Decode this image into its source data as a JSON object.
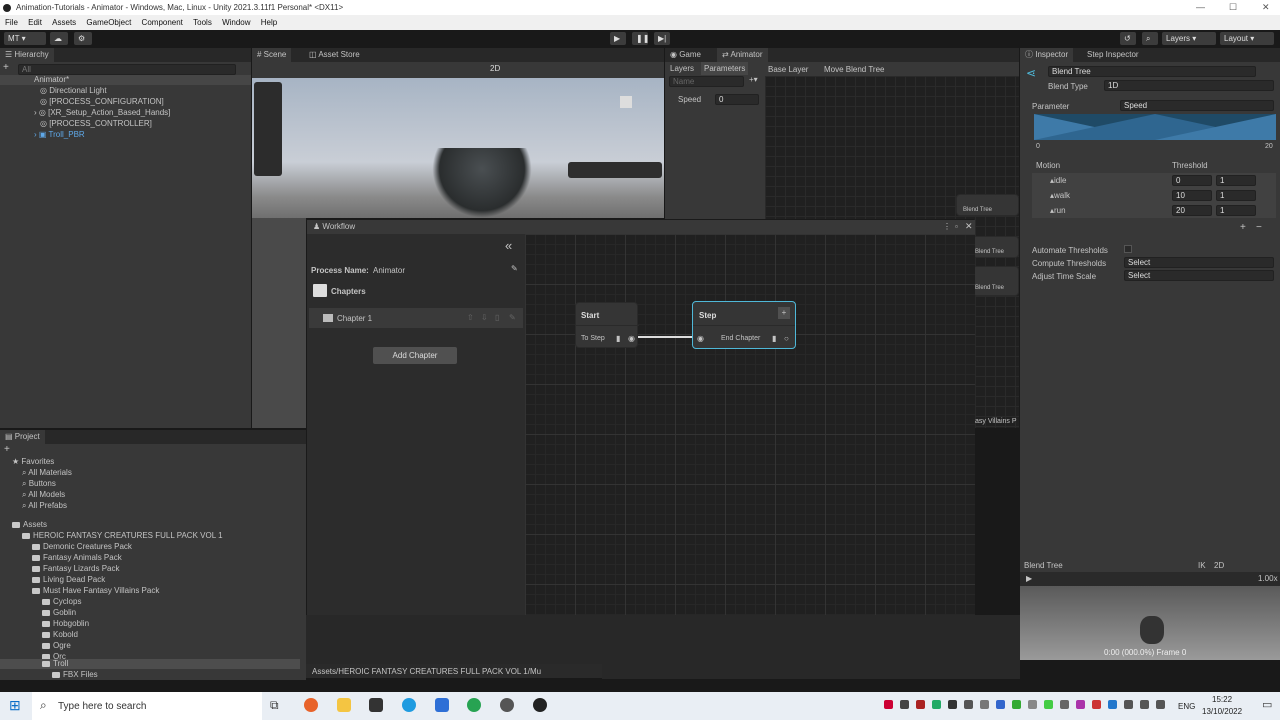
{
  "window": {
    "title": "Animation-Tutorials - Animator - Windows, Mac, Linux - Unity 2021.3.11f1 Personal* <DX11>"
  },
  "menu": [
    "File",
    "Edit",
    "Assets",
    "GameObject",
    "Component",
    "Tools",
    "Window",
    "Help"
  ],
  "toolbar": {
    "account": "MT",
    "layers": "Layers",
    "layout": "Layout"
  },
  "hierarchy": {
    "tab": "Hierarchy",
    "search_placeholder": "All",
    "root": "Animator*",
    "items": [
      "Directional Light",
      "[PROCESS_CONFIGURATION]",
      "[XR_Setup_Action_Based_Hands]",
      "[PROCESS_CONTROLLER]",
      "Troll_PBR"
    ]
  },
  "scene": {
    "tabs": [
      "Scene",
      "Asset Store"
    ],
    "mode_2d": "2D"
  },
  "animator": {
    "tabs": [
      "Game",
      "Animator"
    ],
    "subtabs": [
      "Layers",
      "Parameters"
    ],
    "breadcrumb": [
      "Base Layer",
      "Move Blend Tree"
    ],
    "search_placeholder": "Name",
    "param_name": "Speed",
    "param_value": "0",
    "bg_nodes": [
      "Blend Tree",
      "Blend Tree",
      "Blend Tree"
    ],
    "bg_text": "asy Villains P"
  },
  "workflow": {
    "title": "Workflow",
    "process_label": "Process Name:",
    "process_name": "Animator",
    "chapters_label": "Chapters",
    "chapter1": "Chapter 1",
    "add_chapter": "Add Chapter",
    "start_node": {
      "title": "Start",
      "port": "To Step"
    },
    "step_node": {
      "title": "Step",
      "port": "End Chapter"
    }
  },
  "inspector": {
    "tabs": [
      "Inspector",
      "Step Inspector"
    ],
    "name": "Blend Tree",
    "blend_type_label": "Blend Type",
    "blend_type_value": "1D",
    "parameter_label": "Parameter",
    "parameter_value": "Speed",
    "graph_min": "0",
    "graph_max": "20",
    "motion_header": "Motion",
    "threshold_header": "Threshold",
    "motions": [
      {
        "name": "idle",
        "threshold": "0",
        "speed": "1"
      },
      {
        "name": "walk",
        "threshold": "10",
        "speed": "1"
      },
      {
        "name": "run",
        "threshold": "20",
        "speed": "1"
      }
    ],
    "automate_label": "Automate Thresholds",
    "compute_label": "Compute Thresholds",
    "compute_value": "Select",
    "adjust_label": "Adjust Time Scale",
    "adjust_value": "Select",
    "preview_title": "Blend Tree",
    "preview_ik": "IK",
    "preview_2d": "2D",
    "preview_speed": "1.00x",
    "preview_status": "0:00 (000.0%) Frame 0"
  },
  "project": {
    "tab": "Project",
    "favorites": "Favorites",
    "fav_items": [
      "All Materials",
      "Buttons",
      "All Models",
      "All Prefabs"
    ],
    "assets": "Assets",
    "folders": [
      "HEROIC FANTASY CREATURES FULL PACK VOL 1",
      "Demonic Creatures Pack",
      "Fantasy Animals Pack",
      "Fantasy Lizards Pack",
      "Living Dead Pack",
      "Must Have Fantasy Villains Pack",
      "Cyclops",
      "Goblin",
      "Hobgoblin",
      "Kobold",
      "Ogre",
      "Orc",
      "Troll",
      "FBX Files"
    ],
    "path": "Assets/HEROIC FANTASY CREATURES FULL PACK VOL 1/Mu"
  },
  "taskbar": {
    "search_placeholder": "Type here to search",
    "lang": "ENG",
    "time": "15:22",
    "date": "13/10/2022"
  },
  "colors": {
    "accent": "#2c5d87",
    "selection_cyan": "#4fb8d8",
    "bg": "#383838"
  }
}
